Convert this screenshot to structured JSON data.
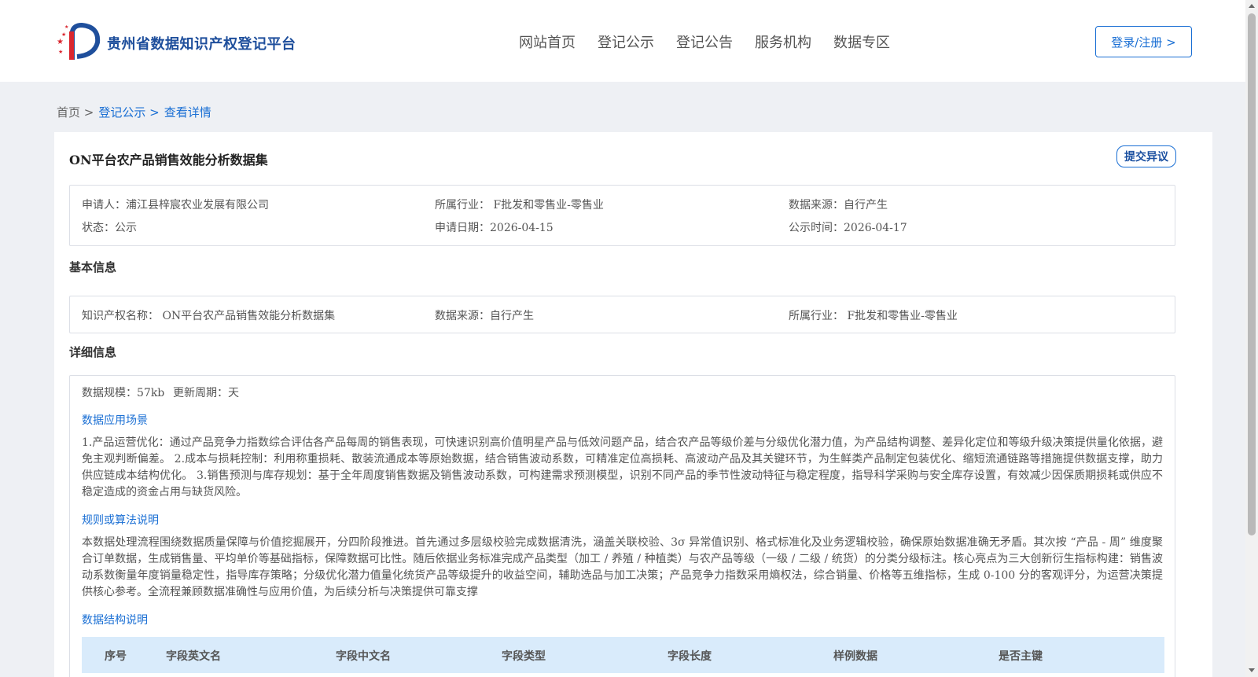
{
  "header": {
    "brand": "贵州省数据知识产权登记平台",
    "nav": [
      "网站首页",
      "登记公示",
      "登记公告",
      "服务机构",
      "数据专区"
    ],
    "login_label": "登录/注册 >"
  },
  "breadcrumb": {
    "home": "首页 >",
    "level2": "登记公示 >",
    "current": "查看详情"
  },
  "detail": {
    "title": "ON平台农产品销售效能分析数据集",
    "objection_label": "提交异议",
    "summary": {
      "applicant": "申请人：浦江县梓宸农业发展有限公司",
      "industry": "所属行业： F批发和零售业-零售业",
      "source": "数据来源：自行产生",
      "status": "状态：公示",
      "apply_date": "申请日期：2026-04-15",
      "publish_date": "公示时间：2026-04-17"
    },
    "basic": {
      "heading": "基本信息",
      "ip_name": "知识产权名称： ON平台农产品销售效能分析数据集",
      "source": "数据来源：自行产生",
      "industry": "所属行业： F批发和零售业-零售业"
    },
    "info": {
      "heading": "详细信息",
      "scale": "数据规模：57kb",
      "cycle": "更新周期：天",
      "scenario_heading": "数据应用场景",
      "scenario_text": "1.产品运营优化：通过产品竞争力指数综合评估各产品每周的销售表现，可快速识别高价值明星产品与低效问题产品，结合农产品等级价差与分级优化潜力值，为产品结构调整、差异化定位和等级升级决策提供量化依据，避免主观判断偏差。 2.成本与损耗控制：利用称重损耗、散装流通成本等原始数据，结合销售波动系数，可精准定位高损耗、高波动产品及其关键环节，为生鲜类产品制定包装优化、缩短流通链路等措施提供数据支撑，助力供应链成本结构优化。 3.销售预测与库存规划：基于全年周度销售数据及销售波动系数，可构建需求预测模型，识别不同产品的季节性波动特征与稳定程度，指导科学采购与安全库存设置，有效减少因保质期损耗或供应不稳定造成的资金占用与缺货风险。",
      "rules_heading": "规则或算法说明",
      "rules_text": "本数据处理流程围绕数据质量保障与价值挖掘展开，分四阶段推进。首先通过多层级校验完成数据清洗，涵盖关联校验、3σ 异常值识别、格式标准化及业务逻辑校验，确保原始数据准确无矛盾。其次按 “产品 - 周” 维度聚合订单数据，生成销售量、平均单价等基础指标，保障数据可比性。随后依据业务标准完成产品类型（加工 / 养殖 / 种植类）与农产品等级（一级 / 二级 / 统货）的分类分级标注。核心亮点为三大创新衍生指标构建：销售波动系数衡量年度销量稳定性，指导库存策略；分级优化潜力值量化统货产品等级提升的收益空间，辅助选品与加工决策；产品竞争力指数采用熵权法，综合销量、价格等五维指标，生成 0-100 分的客观评分，为运营决策提供核心参考。全流程兼顾数据准确性与应用价值，为后续分析与决策提供可靠支撑",
      "structure_heading": "数据结构说明",
      "table_headers": [
        "序号",
        "字段英文名",
        "字段中文名",
        "字段类型",
        "字段长度",
        "样例数据",
        "是否主键"
      ]
    }
  },
  "colors": {
    "brand": "#1f4f9c",
    "link": "#1a6fd4",
    "table_header_bg": "#d9ebfb",
    "page_bg": "#eef0f4"
  }
}
